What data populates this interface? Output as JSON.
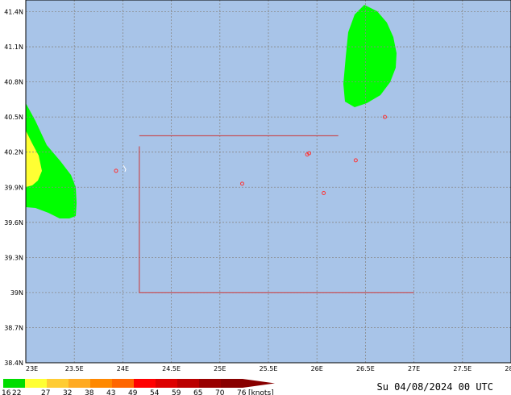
{
  "map": {
    "lon_range": [
      23,
      28
    ],
    "lat_range": [
      38.4,
      41.5
    ],
    "lon_labels": [
      "23E",
      "23.5E",
      "24E",
      "24.5E",
      "25E",
      "25.5E",
      "26E",
      "26.5E",
      "27E",
      "27.5E",
      "28E"
    ],
    "lat_labels": [
      "38.4N",
      "38.7N",
      "39N",
      "39.3N",
      "39.6N",
      "39.9N",
      "40.2N",
      "40.5N",
      "40.8N",
      "41.1N",
      "41.4N"
    ],
    "lon_ticks": [
      23,
      23.5,
      24,
      24.5,
      25,
      25.5,
      26,
      26.5,
      27,
      27.5,
      28
    ],
    "lat_ticks": [
      38.4,
      38.7,
      39.0,
      39.3,
      39.6,
      39.9,
      40.2,
      40.5,
      40.8,
      41.1,
      41.4
    ],
    "colors": {
      "sea": "#a8c4e8",
      "grid": "#888888",
      "frame": "#000000",
      "green": "#00ff00",
      "yellow": "#ffff33",
      "marker": "#ff3333",
      "domain_box": "#cc3333"
    },
    "markers": [
      {
        "lon": 23.93,
        "lat": 40.04
      },
      {
        "lon": 25.23,
        "lat": 39.93
      },
      {
        "lon": 25.9,
        "lat": 40.18
      },
      {
        "lon": 25.92,
        "lat": 40.19
      },
      {
        "lon": 26.07,
        "lat": 39.85
      },
      {
        "lon": 26.4,
        "lat": 40.13
      },
      {
        "lon": 26.7,
        "lat": 40.5
      }
    ],
    "domain_lines": [
      [
        [
          24.17,
          40.34
        ],
        [
          26.22,
          40.34
        ]
      ],
      [
        [
          24.17,
          40.25
        ],
        [
          24.17,
          39.0
        ],
        [
          27.0,
          39.0
        ]
      ]
    ]
  },
  "legend": {
    "labels": [
      "16",
      "22",
      "27",
      "32",
      "38",
      "43",
      "49",
      "54",
      "59",
      "65",
      "70",
      "76",
      "[knots]"
    ],
    "colors": [
      "#00dd00",
      "#ffff33",
      "#ffcc33",
      "#ffaa22",
      "#ff8800",
      "#ff6600",
      "#ff0000",
      "#dd0000",
      "#bb0000",
      "#990000",
      "#880000"
    ]
  },
  "timestamp": "Su 04/08/2024 00 UTC"
}
